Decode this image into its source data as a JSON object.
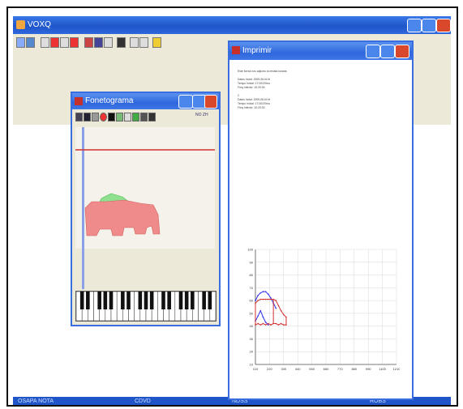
{
  "app": {
    "title": "VOXQ",
    "statusbar": [
      "OSAPA  NOTA",
      "CDVD",
      "NDSS",
      "ROBS"
    ]
  },
  "colors": {
    "titlebar": "#2f67dd",
    "close_button": "#d9482b",
    "window_bg": "#ece9d8",
    "fill_red": "#f08b8b",
    "fill_green": "#8fe08f",
    "line_red": "#d23030",
    "line_blue": "#2e2ef0",
    "vertical_cursor": "#8aa0e8"
  },
  "fonetograma": {
    "title": "Fonetograma",
    "zoom_label": "NO ZH"
  },
  "imprimir": {
    "title": "Imprimir",
    "text_lines": [
      "Este forma nos adjunto la revista ionaria",
      "",
      "Datos Incial: 2009-06-ht-ht",
      "Tempo Inicial: 17/10/20/ea",
      "Freq Inferior: 10:20:30",
      "",
      "2",
      "Datos Incial: 2009-06-ht-ht",
      "Tempo Inicial: 17/10/20/ea",
      "Freq Inferior: 10:20:30"
    ],
    "chart_data": {
      "type": "line",
      "y_ticks": [
        "100",
        "90",
        "80",
        "70",
        "60",
        "50",
        "40",
        "30",
        "20",
        "10"
      ],
      "x_ticks": [
        "110",
        "220",
        "330",
        "440",
        "550",
        "660",
        "770",
        "880",
        "990",
        "1100",
        "1210"
      ],
      "ylim": [
        10,
        100
      ],
      "grid": true,
      "series": [
        {
          "color": "#2e2ef0",
          "x": [
            110,
            130,
            150,
            170,
            190,
            210,
            230,
            250,
            270
          ],
          "y": [
            60,
            64,
            66,
            67,
            67,
            65,
            62,
            58,
            54
          ]
        },
        {
          "color": "#d23030",
          "x": [
            110,
            130,
            150,
            170,
            190,
            210,
            230,
            250,
            270,
            290,
            310,
            330,
            350
          ],
          "y": [
            58,
            60,
            61,
            61,
            61,
            61,
            61,
            61,
            60,
            56,
            52,
            49,
            47
          ]
        },
        {
          "color": "#2e2ef0",
          "x": [
            110,
            130,
            150,
            170,
            190,
            210
          ],
          "y": [
            44,
            48,
            52,
            47,
            43,
            41
          ]
        },
        {
          "color": "#d23030",
          "x": [
            110,
            130,
            150,
            170,
            190,
            210,
            230,
            250,
            270,
            290,
            310,
            330,
            350
          ],
          "y": [
            41,
            42,
            41,
            42,
            41,
            42,
            41,
            42,
            42,
            41,
            42,
            41,
            41
          ]
        }
      ]
    }
  }
}
